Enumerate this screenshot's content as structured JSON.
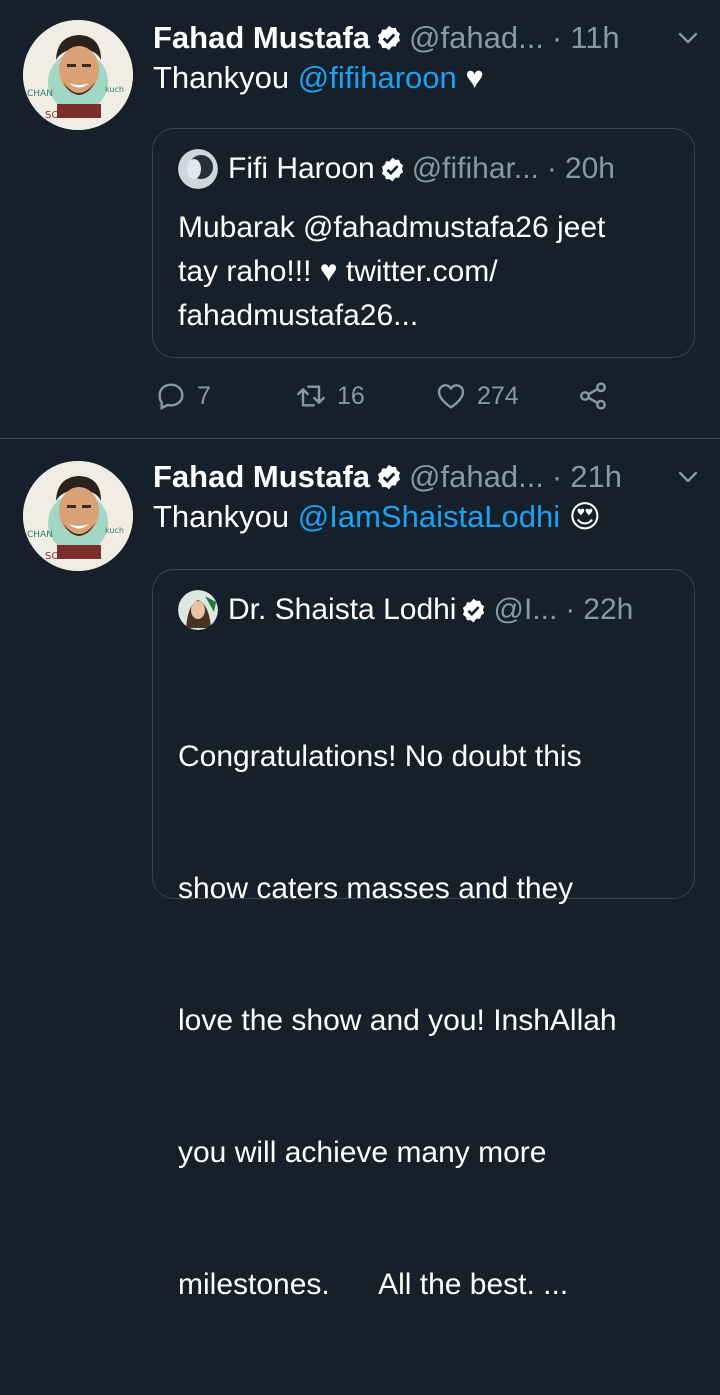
{
  "tweets": [
    {
      "author": "Fahad Mustafa",
      "handle": "@fahad...",
      "time": "11h",
      "text_prefix": "Thankyou ",
      "mention": "@fifiharoon",
      "text_suffix": " ♥",
      "quote": {
        "author": "Fifi Haroon",
        "handle": "@fifihar...",
        "time": "20h",
        "lines": [
          "Mubarak @fahadmustafa26 jeet",
          "tay raho!!! ♥ twitter.com/",
          "fahadmustafa26..."
        ]
      },
      "stats": {
        "replies": "7",
        "retweets": "16",
        "likes": "274"
      }
    },
    {
      "author": "Fahad Mustafa",
      "handle": "@fahad...",
      "time": "21h",
      "text_prefix": "Thankyou ",
      "mention": "@IamShaistaLodhi",
      "emoji": "😍",
      "quote": {
        "author": "Dr. Shaista Lodhi",
        "handle": "@I...",
        "time": "22h",
        "lines": [
          "Congratulations! No doubt this",
          "show caters masses and they",
          "love the show and you! InshAllah",
          "you will achieve many more",
          "milestones.      All the best. ..."
        ]
      }
    }
  ],
  "avatar_text": {
    "left": "CHAN",
    "right": "kuch",
    "bottom": "SOCHLO!"
  },
  "colors": {
    "background": "#15202b",
    "accent": "#1da1f2",
    "muted": "#8899a6",
    "border": "#38444d"
  }
}
